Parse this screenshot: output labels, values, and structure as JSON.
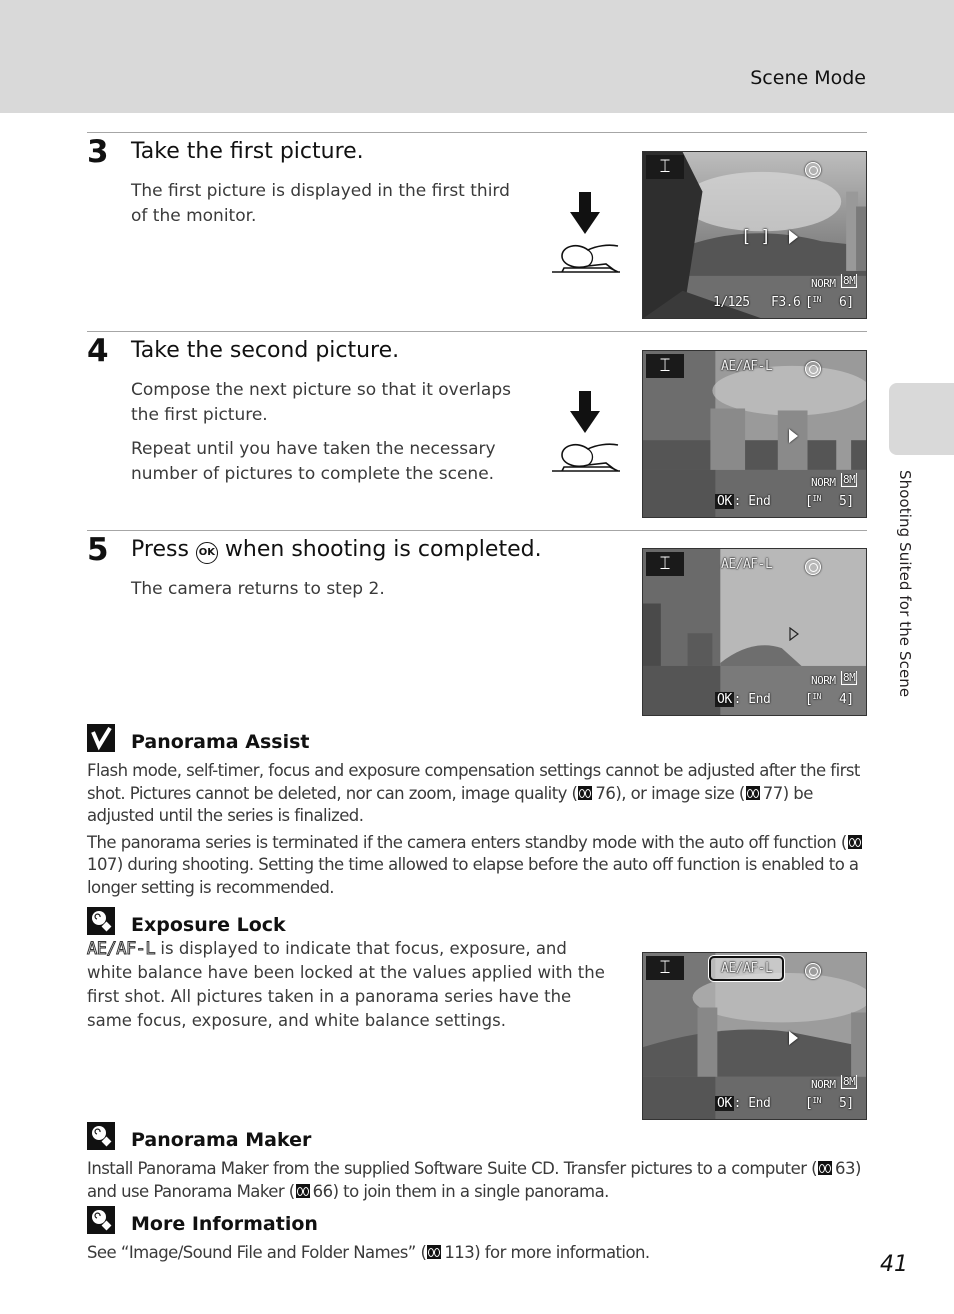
{
  "header": {
    "section_title": "Scene Mode"
  },
  "side_tab": {
    "label": "Shooting Suited for the Scene"
  },
  "steps": [
    {
      "number": "3",
      "title": "Take the first picture.",
      "body": [
        "The first picture is displayed in the first third of the monitor."
      ],
      "shutter_icon": "shutter-press-icon",
      "screen": {
        "mode_icon": "panorama-assist-icon",
        "ae_af_lock": "",
        "vr_icon": "vibration-reduction-icon",
        "focus_brackets": "[ ]",
        "direction": "right",
        "quality": "NORM",
        "image_size": "8M",
        "shutter_speed": "1/125",
        "aperture": "F3.6",
        "memory": "IN",
        "exposures_remaining": "6",
        "end_hint": ""
      }
    },
    {
      "number": "4",
      "title": "Take the second picture.",
      "body": [
        "Compose the next picture so that it overlaps the first picture.",
        "Repeat until you have taken the necessary number of pictures to complete the scene."
      ],
      "shutter_icon": "shutter-press-icon",
      "screen": {
        "mode_icon": "panorama-assist-icon",
        "ae_af_lock": "AE/AF-L",
        "vr_icon": "vibration-reduction-icon",
        "direction": "right",
        "quality": "NORM",
        "image_size": "8M",
        "memory": "IN",
        "exposures_remaining": "5",
        "ok_label": "OK",
        "end_hint": ": End"
      }
    },
    {
      "number": "5",
      "title_pre": "Press",
      "title_button": "OK",
      "title_post": "when shooting is completed.",
      "body": [
        "The camera returns to step 2."
      ],
      "screen": {
        "mode_icon": "panorama-assist-icon",
        "ae_af_lock": "AE/AF-L",
        "vr_icon": "vibration-reduction-icon",
        "direction": "right",
        "quality": "NORM",
        "image_size": "8M",
        "memory": "IN",
        "exposures_remaining": "4",
        "ok_label": "OK",
        "end_hint": ": End"
      }
    }
  ],
  "notes": {
    "panorama_assist": {
      "icon": "checkmark-caution-icon",
      "title": "Panorama Assist",
      "p1_a": "Flash mode, self-timer, focus and exposure compensation settings cannot be adjusted after the first shot. Pictures cannot be deleted, nor can zoom, image quality (",
      "p1_ref1": "76",
      "p1_b": "), or image size (",
      "p1_ref2": "77",
      "p1_c": ") be adjusted until the series is finalized.",
      "p2_a": "The panorama series is terminated if the camera enters standby mode with the auto off function (",
      "p2_ref": "107",
      "p2_b": ") during shooting. Setting the time allowed to elapse before the auto off function is enabled to a longer setting is recommended."
    },
    "exposure_lock": {
      "icon": "tip-bulb-icon",
      "title": "Exposure Lock",
      "lcd_text": "AE/AF-L",
      "body": " is displayed to indicate that focus, exposure, and white balance have been locked at the values applied with the first shot. All pictures taken in a panorama series have the same focus, exposure, and white balance settings.",
      "screen": {
        "mode_icon": "panorama-assist-icon",
        "ae_af_lock": "AE/AF-L",
        "vr_icon": "vibration-reduction-icon",
        "direction": "right",
        "quality": "NORM",
        "image_size": "8M",
        "memory": "IN",
        "exposures_remaining": "5",
        "ok_label": "OK",
        "end_hint": ": End"
      }
    },
    "panorama_maker": {
      "icon": "tip-bulb-icon",
      "title": "Panorama Maker",
      "a": "Install Panorama Maker from the supplied Software Suite CD. Transfer pictures to a computer (",
      "ref1": "63",
      "b": ") and use Panorama Maker (",
      "ref2": "66",
      "c": ") to join them in a single panorama."
    },
    "more_information": {
      "icon": "tip-bulb-icon",
      "title": "More Information",
      "a": "See “Image/Sound File and Folder Names” (",
      "ref": "113",
      "b": ") for more information."
    }
  },
  "page_number": "41"
}
